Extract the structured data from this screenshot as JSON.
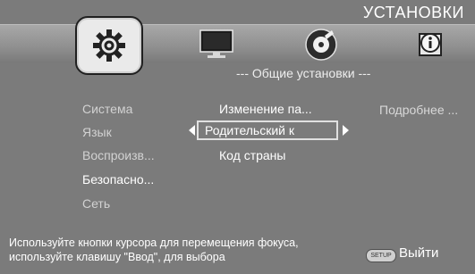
{
  "header": {
    "title": "УСТАНОВКИ"
  },
  "tabs": [
    {
      "name": "system",
      "icon": "gear-icon"
    },
    {
      "name": "display",
      "icon": "monitor-icon"
    },
    {
      "name": "audio",
      "icon": "disc-icon"
    },
    {
      "name": "info",
      "icon": "info-icon"
    }
  ],
  "section": {
    "subtitle": "--- Общие установки ---"
  },
  "left_menu": [
    {
      "label": "Система"
    },
    {
      "label": "Язык"
    },
    {
      "label": "Воспроизв..."
    },
    {
      "label": "Безопасно..."
    },
    {
      "label": "Сеть"
    }
  ],
  "middle_menu": [
    {
      "label": "Изменение па..."
    },
    {
      "label": "Родительский к"
    },
    {
      "label": "Код страны"
    }
  ],
  "right_menu": {
    "label": "Подробнее ..."
  },
  "footer": {
    "line1": "Используйте кнопки курсора для перемещения фокуса,",
    "line2": "используйте клавишу \"Ввод\", для выбора",
    "setup_button": "SETUP",
    "exit_label": "Выйти"
  },
  "colors": {
    "background": "#7b7b7b",
    "text": "#ffffff",
    "dim_text": "#d2d2d2"
  }
}
